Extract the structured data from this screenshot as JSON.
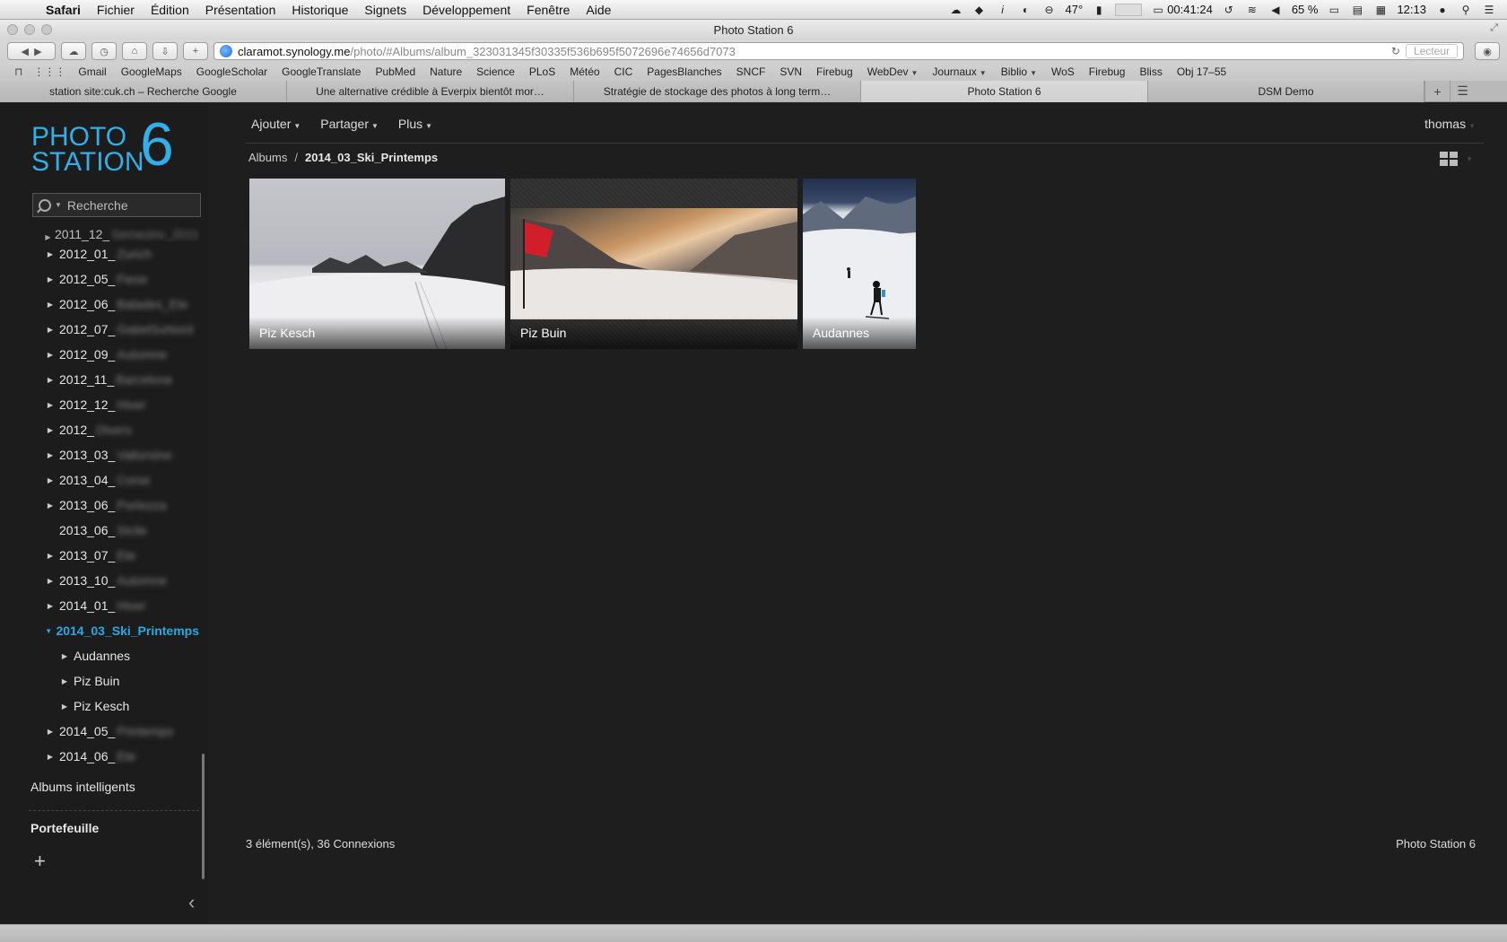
{
  "menubar": {
    "app": "Safari",
    "items": [
      "Fichier",
      "Édition",
      "Présentation",
      "Historique",
      "Signets",
      "Développement",
      "Fenêtre",
      "Aide"
    ],
    "temperature": "47°",
    "timer": "00:41:24",
    "battery": "65 %",
    "clock": "12:13"
  },
  "window": {
    "title": "Photo Station 6"
  },
  "toolbar": {
    "url_host": "claramot.synology.me",
    "url_path": "/photo/#Albums/album_323031345f30335f536b695f5072696e74656d7073",
    "reader_label": "Lecteur"
  },
  "bookmarks": [
    "Gmail",
    "GoogleMaps",
    "GoogleScholar",
    "GoogleTranslate",
    "PubMed",
    "Nature",
    "Science",
    "PLoS",
    "Météo",
    "CIC",
    "PagesBlanches",
    "SNCF",
    "SVN",
    "Firebug",
    "WebDev",
    "Journaux",
    "Biblio",
    "WoS",
    "Firebug",
    "Bliss",
    "Obj 17–55"
  ],
  "tabs": [
    {
      "label": "station site:cuk.ch – Recherche Google",
      "active": false
    },
    {
      "label": "Une alternative crédible à Everpix bientôt mor…",
      "active": false
    },
    {
      "label": "Stratégie de stockage des photos à long term…",
      "active": false
    },
    {
      "label": "Photo Station 6",
      "active": true
    },
    {
      "label": "DSM Demo",
      "active": false
    }
  ],
  "sidebar": {
    "logo": {
      "line1": "PHOTO",
      "line2": "STATION",
      "number": "6"
    },
    "search_placeholder": "Recherche",
    "tree": [
      {
        "label": "2011_12_",
        "blur": "Semestre_2011",
        "level": 1,
        "expand": "collapsed",
        "partial": true
      },
      {
        "label": "2012_01_",
        "blur": "Zurich",
        "level": 1,
        "expand": "collapsed"
      },
      {
        "label": "2012_05_",
        "blur": "Fiese",
        "level": 1,
        "expand": "collapsed"
      },
      {
        "label": "2012_06_",
        "blur": "Balades_Ete",
        "level": 1,
        "expand": "collapsed"
      },
      {
        "label": "2012_07_",
        "blur": "GabelSuNord",
        "level": 1,
        "expand": "collapsed"
      },
      {
        "label": "2012_09_",
        "blur": "Automne",
        "level": 1,
        "expand": "collapsed"
      },
      {
        "label": "2012_11_",
        "blur": "Barcelone",
        "level": 1,
        "expand": "collapsed"
      },
      {
        "label": "2012_12_",
        "blur": "Hiver",
        "level": 1,
        "expand": "collapsed"
      },
      {
        "label": "2012_",
        "blur": "Divers",
        "level": 1,
        "expand": "collapsed"
      },
      {
        "label": "2013_03_",
        "blur": "Valtorsine",
        "level": 1,
        "expand": "collapsed"
      },
      {
        "label": "2013_04_",
        "blur": "Corse",
        "level": 1,
        "expand": "collapsed"
      },
      {
        "label": "2013_06_",
        "blur": "Portezza",
        "level": 1,
        "expand": "collapsed"
      },
      {
        "label": "2013_06_",
        "blur": "Sicile",
        "level": 1,
        "expand": "none"
      },
      {
        "label": "2013_07_",
        "blur": "Ete",
        "level": 1,
        "expand": "collapsed"
      },
      {
        "label": "2013_10_",
        "blur": "Automne",
        "level": 1,
        "expand": "collapsed"
      },
      {
        "label": "2014_01_",
        "blur": "Hiver",
        "level": 1,
        "expand": "collapsed"
      },
      {
        "label": "2014_03_Ski_Printemps",
        "blur": "",
        "level": 1,
        "expand": "expanded",
        "active": true
      },
      {
        "label": "Audannes",
        "blur": "",
        "level": 2,
        "expand": "collapsed"
      },
      {
        "label": "Piz Buin",
        "blur": "",
        "level": 2,
        "expand": "collapsed"
      },
      {
        "label": "Piz Kesch",
        "blur": "",
        "level": 2,
        "expand": "collapsed"
      },
      {
        "label": "2014_05_",
        "blur": "Printemps",
        "level": 1,
        "expand": "collapsed"
      },
      {
        "label": "2014_06_",
        "blur": "Ete",
        "level": 1,
        "expand": "collapsed"
      }
    ],
    "smart_albums": "Albums intelligents",
    "portfolio": "Portefeuille",
    "add_symbol": "+"
  },
  "main": {
    "nav": [
      "Ajouter",
      "Partager",
      "Plus"
    ],
    "user": "thomas",
    "breadcrumb": {
      "root": "Albums",
      "separator": "/",
      "current": "2014_03_Ski_Printemps"
    },
    "albums": [
      {
        "title": "Piz Kesch"
      },
      {
        "title": "Piz Buin"
      },
      {
        "title": "Audannes"
      }
    ],
    "status": "3 élément(s), 36 Connexions",
    "brand": "Photo Station 6"
  }
}
